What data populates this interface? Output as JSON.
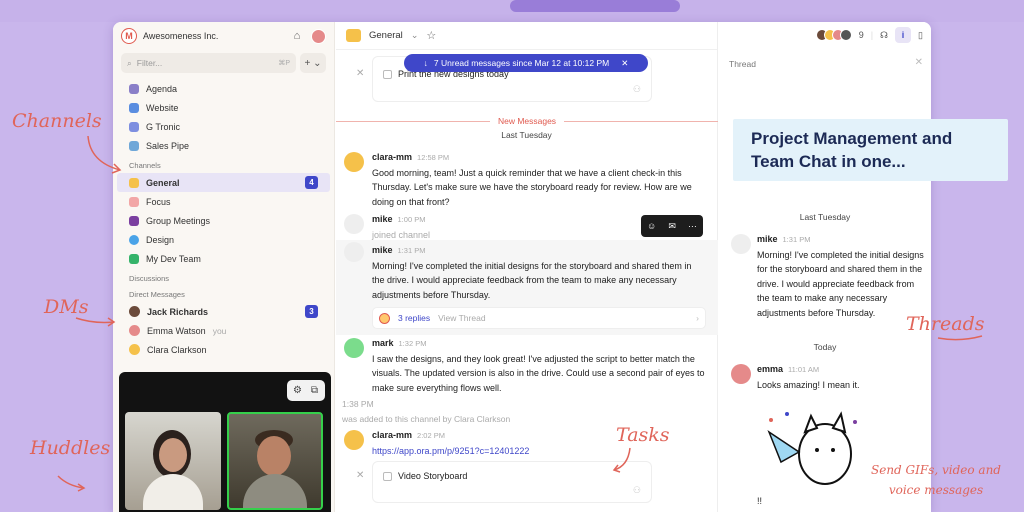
{
  "workspace": {
    "name": "Awesomeness Inc."
  },
  "sidebar": {
    "filter_placeholder": "Filter...",
    "filter_shortcut": "⌘P",
    "plus_label": "+ ⌄",
    "pinned": [
      {
        "label": "Agenda",
        "color": "#8a7fc8"
      },
      {
        "label": "Website",
        "color": "#5a8de0"
      },
      {
        "label": "G Tronic",
        "color": "#7d8ee0"
      },
      {
        "label": "Sales Pipe",
        "color": "#6fa7d8"
      }
    ],
    "channels_label": "Channels",
    "channels": [
      {
        "label": "General",
        "badge": "4",
        "color": "#f5c14a"
      },
      {
        "label": "Focus",
        "color": "#f2a6a6"
      },
      {
        "label": "Group Meetings",
        "color": "#7b3fa0"
      },
      {
        "label": "Design",
        "color": "#4aa3e8"
      },
      {
        "label": "My Dev Team",
        "color": "#35b36a"
      }
    ],
    "discussions_label": "Discussions",
    "dm_label": "Direct Messages",
    "dms": [
      {
        "label": "Jack Richards",
        "badge": "3",
        "you": ""
      },
      {
        "label": "Emma Watson",
        "you": "you"
      },
      {
        "label": "Clara Clarkson",
        "you": ""
      }
    ]
  },
  "main": {
    "channel": "General",
    "unread_banner": "7 Unread messages since Mar 12 at 10:12 PM",
    "top_task": "Print the new designs today",
    "new_messages_label": "New Messages",
    "date_sep": "Last Tuesday",
    "messages": [
      {
        "name": "clara-mm",
        "time": "12:58 PM",
        "text": "Good morning, team! Just a quick reminder that we have a client check-in this Thursday. Let's make sure we have the storyboard ready for review. How are we doing on that front?"
      },
      {
        "name": "mike",
        "time": "1:00 PM",
        "text": "joined channel"
      },
      {
        "name": "mike",
        "time": "1:31 PM",
        "text": "Morning! I've completed the initial designs for the storyboard and shared them in the drive. I would appreciate feedback from the team to make any necessary adjustments before Thursday."
      },
      {
        "name": "mark",
        "time": "1:32 PM",
        "text": "I saw the designs, and they look great! I've adjusted the script to better match the visuals. The updated version is also in the drive. Could use a second pair of eyes to make sure everything flows well."
      },
      {
        "name": "clara-mm",
        "time": "2:02 PM",
        "text": "https://app.ora.pm/p/9251?c=12401222"
      }
    ],
    "replies_label": "3 replies",
    "view_thread": "View Thread",
    "system_time": "1:38 PM",
    "system_text": "was added to this channel by Clara Clarkson",
    "bottom_task": "Video Storyboard"
  },
  "topbar": {
    "member_count": "9"
  },
  "thread": {
    "label": "Thread",
    "date_sep": "Last Tuesday",
    "today_label": "Today",
    "messages": [
      {
        "name": "mike",
        "time": "1:31 PM",
        "text": "Morning! I've completed the initial designs for the storyboard and shared them in the drive. I would appreciate feedback from the team to make any necessary adjustments before Thursday."
      },
      {
        "name": "emma",
        "time": "11:01 AM",
        "text": "Looks amazing! I mean it."
      }
    ],
    "trailing": "!!"
  },
  "callout": "Project Management and Team Chat in one...",
  "annotations": {
    "channels": "Channels",
    "dms": "DMs",
    "huddles": "Huddles",
    "tasks": "Tasks",
    "threads": "Threads",
    "gifs": "Send GIFs, video and voice messages"
  },
  "colors": {
    "accent": "#3f47c9",
    "annotation": "#e0655a",
    "background": "#c9b6ec"
  }
}
